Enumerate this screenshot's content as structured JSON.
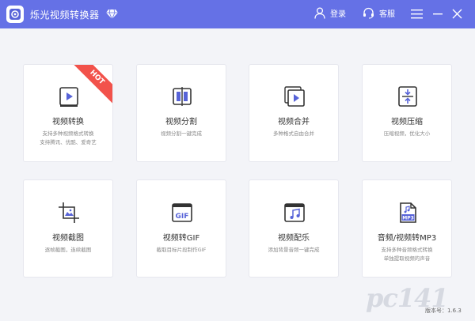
{
  "app": {
    "title": "烁光视频转换器",
    "login_label": "登录",
    "service_label": "客服",
    "version": "版本号：1.6.3",
    "watermark": "pc141"
  },
  "colors": {
    "titlebar": "#6571e6",
    "icon_accent": "#5763d8",
    "hot_badge": "#f2524b"
  },
  "cards": [
    {
      "label": "视频转换",
      "desc": "支持多种视频格式转换\n支持腾讯、优酷、爱奇艺",
      "icon": "video-convert-icon",
      "badge": "HOT"
    },
    {
      "label": "视频分割",
      "desc": "视频分割一键完成",
      "icon": "video-split-icon"
    },
    {
      "label": "视频合并",
      "desc": "多种格式自由合并",
      "icon": "video-merge-icon"
    },
    {
      "label": "视频压缩",
      "desc": "压缩视频，优化大小",
      "icon": "video-compress-icon"
    },
    {
      "label": "视频截图",
      "desc": "逐帧截图，连续截图",
      "icon": "video-screenshot-icon"
    },
    {
      "label": "视频转GIF",
      "desc": "截取目标片段制作GIF",
      "icon": "gif-icon"
    },
    {
      "label": "视频配乐",
      "desc": "添加背景音频一键完成",
      "icon": "music-note-icon"
    },
    {
      "label": "音频/视频转MP3",
      "desc": "支持多种音频格式转换\n单独提取视频的声音",
      "icon": "mp3-icon"
    }
  ]
}
